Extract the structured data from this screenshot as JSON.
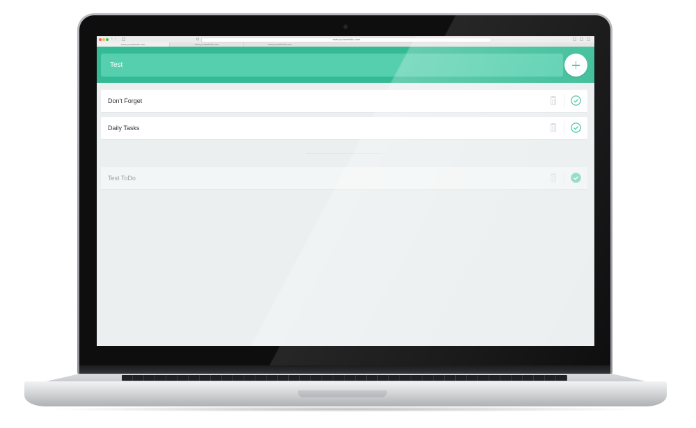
{
  "browser": {
    "url": "www.yourwebsite.com",
    "tabs": [
      "www.yourwebsite.com",
      "www.yourwebsite.com",
      "www.yourwebsite.com"
    ]
  },
  "header": {
    "title": "Test",
    "add_icon": "plus-icon"
  },
  "lists": [
    {
      "title": "Don't Forget",
      "done": false
    },
    {
      "title": "Daily Tasks",
      "done": false
    }
  ],
  "completed": [
    {
      "title": "Test ToDo",
      "done": true
    }
  ],
  "icons": {
    "delete": "trash-icon",
    "complete": "check-circle-icon"
  },
  "colors": {
    "accent": "#34bb95",
    "accent_light": "#55cfae",
    "background": "#ebeff0"
  }
}
